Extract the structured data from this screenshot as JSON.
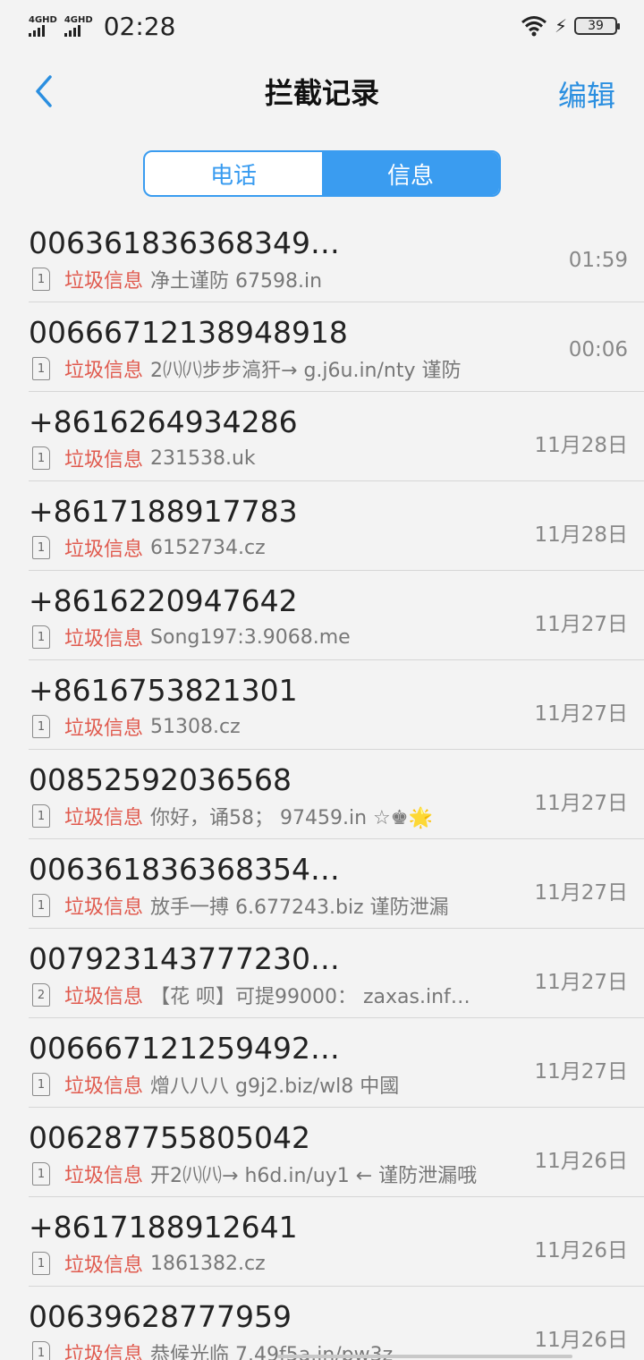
{
  "status_bar": {
    "sim1_label": "4GHD",
    "sim2_label": "4GHD",
    "time": "02:28",
    "battery": "39"
  },
  "header": {
    "title": "拦截记录",
    "edit_label": "编辑"
  },
  "tabs": [
    {
      "label": "电话",
      "active": false
    },
    {
      "label": "信息",
      "active": true
    }
  ],
  "messages": [
    {
      "sender": "006361836368349…",
      "sim": "1",
      "tag": "垃圾信息",
      "preview": "净土谨防 67598.in",
      "time": "01:59"
    },
    {
      "sender": "00666712138948918",
      "sim": "1",
      "tag": "垃圾信息",
      "preview": "2㈧㈧步步滈犴→  g.j6u.in/nty   谨防",
      "time": "00:06"
    },
    {
      "sender": "+8616264934286",
      "sim": "1",
      "tag": "垃圾信息",
      "preview": " 231538.uk",
      "time": "11月28日"
    },
    {
      "sender": "+8617188917783",
      "sim": "1",
      "tag": "垃圾信息",
      "preview": "6152734.cz",
      "time": "11月28日"
    },
    {
      "sender": "+8616220947642",
      "sim": "1",
      "tag": "垃圾信息",
      "preview": "Song197:3.9068.me",
      "time": "11月27日"
    },
    {
      "sender": "+8616753821301",
      "sim": "1",
      "tag": "垃圾信息",
      "preview": "51308.cz",
      "time": "11月27日"
    },
    {
      "sender": "00852592036568",
      "sim": "1",
      "tag": "垃圾信息",
      "preview": "你好，诵58；  97459.in ☆♚🌟",
      "time": "11月27日"
    },
    {
      "sender": "006361836368354…",
      "sim": "1",
      "tag": "垃圾信息",
      "preview": "放手一搏  6.677243.biz   谨防泄漏",
      "time": "11月27日"
    },
    {
      "sender": "007923143777230…",
      "sim": "2",
      "tag": "垃圾信息",
      "preview": "【花 呗】可提99000：  zaxas.inf…",
      "time": "11月27日"
    },
    {
      "sender": "006667121259492…",
      "sim": "1",
      "tag": "垃圾信息",
      "preview": "熷八八八    g9j2.biz/wl8      中國",
      "time": "11月27日"
    },
    {
      "sender": "006287755805042",
      "sim": "1",
      "tag": "垃圾信息",
      "preview": "开2㈧㈧→ h6d.in/uy1 ← 谨防泄漏哦",
      "time": "11月26日"
    },
    {
      "sender": "+8617188912641",
      "sim": "1",
      "tag": "垃圾信息",
      "preview": "1861382.cz",
      "time": "11月26日"
    },
    {
      "sender": "00639628777959",
      "sim": "1",
      "tag": "垃圾信息",
      "preview": "恭候光临 7.49f5a.in/pw3z",
      "time": "11月26日"
    }
  ]
}
